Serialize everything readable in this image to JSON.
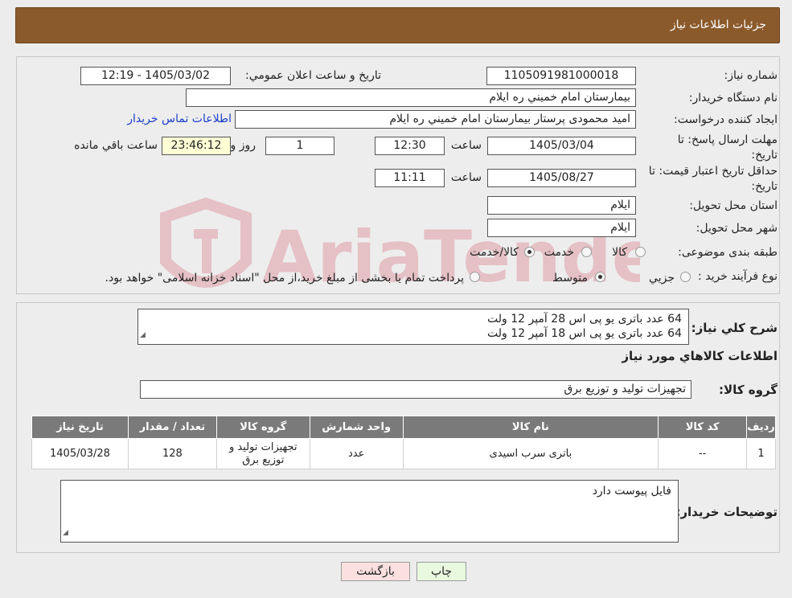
{
  "header": {
    "title": "جزئیات اطلاعات نیاز"
  },
  "watermark": {
    "text": "AriaTender.neT"
  },
  "info": {
    "need_number_label": "شماره نیاز:",
    "need_number": "1105091981000018",
    "announce_label": "تاريخ و ساعت اعلان عمومي:",
    "announce_value": "1405/03/02 - 12:19",
    "buyer_org_label": "نام دستگاه خريدار:",
    "buyer_org": "بيمارستان امام خميني  ره  ايلام",
    "creator_label": "ايجاد كننده درخواست:",
    "creator": "اميد محمودی پرستار بيمارستان امام خميني  ره  ايلام",
    "contact_link": "اطلاعات تماس خريدار",
    "deadline_label_1": "مهلت ارسال پاسخ: تا",
    "deadline_label_2": "تاريخ:",
    "deadline_date": "1405/03/04",
    "time_label": "ساعت",
    "deadline_time": "12:30",
    "days_value": "1",
    "days_label": "روز و",
    "remaining_value": "23:46:12",
    "remaining_label": "ساعت باقي مانده",
    "validity_label_1": "حداقل تاريخ اعتبار قيمت: تا",
    "validity_label_2": "تاريخ:",
    "validity_date": "1405/08/27",
    "validity_time": "11:11",
    "province_label": "استان محل تحويل:",
    "province": "ايلام",
    "city_label": "شهر محل تحويل:",
    "city": "ايلام",
    "category_label": "طبقه بندی موضوعی:",
    "category_options": [
      "كالا",
      "خدمت",
      "كالا/خدمت"
    ],
    "category_selected": "كالا/خدمت",
    "process_label": "نوع فرآيند خريد :",
    "process_options": [
      "جزيي",
      "متوسط"
    ],
    "process_selected": "متوسط",
    "process_note": "پرداخت تمام يا بخشی از مبلغ خريد،از محل \"اسناد خزانه اسلامی\" خواهد بود."
  },
  "details": {
    "description_label": "شرح كلي نياز:",
    "description_lines": [
      "64 عدد باتری یو پی اس 28 آمپر 12 ولت",
      "64 عدد باتری یو پی اس 18 آمپر 12 ولت"
    ],
    "goods_title": "اطلاعات كالاهاي مورد نياز",
    "goods_group_label": "گروه كالا:",
    "goods_group": "تجهيزات توليد و توزيع برق",
    "table_headers": [
      "رديف",
      "كد كالا",
      "نام كالا",
      "واحد شمارش",
      "گروه كالا",
      "تعداد / مقدار",
      "تاريخ نياز"
    ],
    "rows": [
      {
        "index": "1",
        "code": "--",
        "name": "باتری سرب اسیدی",
        "unit": "عدد",
        "group": "تجهيزات توليد و توزيع برق",
        "qty": "128",
        "date": "1405/03/28"
      }
    ],
    "buyer_notes_label": "توضيحات خريدار:",
    "buyer_notes": "فایل پیوست دارد"
  },
  "buttons": {
    "print": "چاپ",
    "back": "بازگشت"
  }
}
